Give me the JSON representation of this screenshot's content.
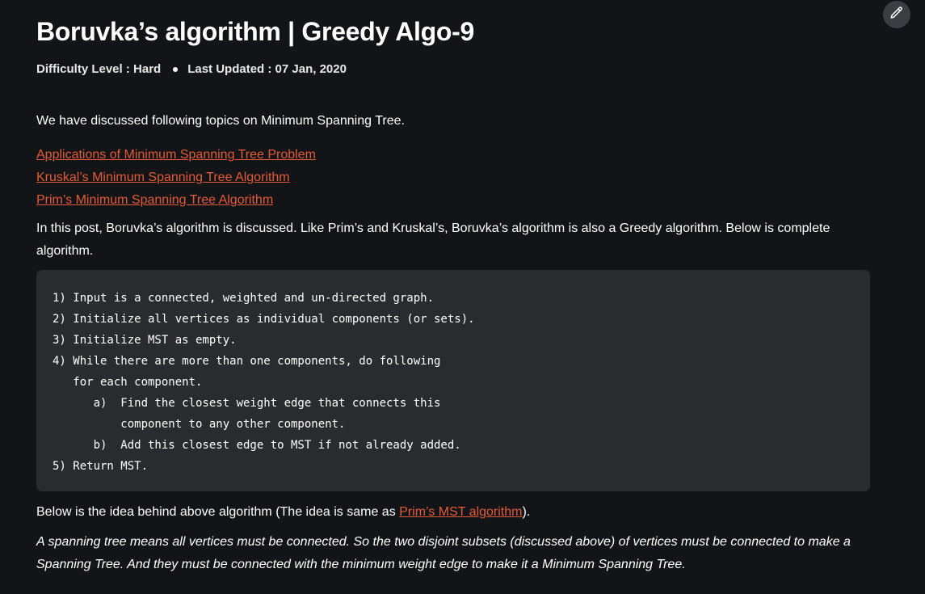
{
  "article": {
    "title": "Boruvka’s algorithm | Greedy Algo-9",
    "difficulty": "Difficulty Level : Hard",
    "last_updated": "Last Updated : 07 Jan, 2020",
    "intro": "We have discussed following topics on Minimum Spanning Tree.",
    "links": [
      "Applications of Minimum Spanning Tree Problem",
      "Kruskal’s Minimum Spanning Tree Algorithm",
      "Prim’s Minimum Spanning Tree Algorithm"
    ],
    "paragraph": "In this post, Boruvka’s algorithm is discussed. Like Prim’s and Kruskal’s, Boruvka’s algorithm is also a Greedy algorithm. Below is complete algorithm.",
    "code_lines": [
      "1) Input is a connected, weighted and un-directed graph.",
      "2) Initialize all vertices as individual components (or sets).",
      "3) Initialize MST as empty.",
      "4) While there are more than one components, do following",
      "   for each component.",
      "      a)  Find the closest weight edge that connects this",
      "          component to any other component.",
      "      b)  Add this closest edge to MST if not already added.",
      "5) Return MST."
    ],
    "idea_prefix": "Below is the idea behind above algorithm (The idea is same as ",
    "idea_link": "Prim’s MST algorithm",
    "idea_suffix": ").",
    "italic_text": "A spanning tree means all vertices must be connected. So the two disjoint subsets (discussed above) of vertices must be connected to make a Spanning Tree. And they must be connected with the minimum weight edge to make it a Minimum Spanning Tree."
  },
  "toolbar": {
    "edit_icon": "pencil-icon"
  },
  "colors": {
    "background": "#131417",
    "link": "#e35b36",
    "code_background": "#2a2b2e",
    "edit_button": "#3b3d42"
  }
}
